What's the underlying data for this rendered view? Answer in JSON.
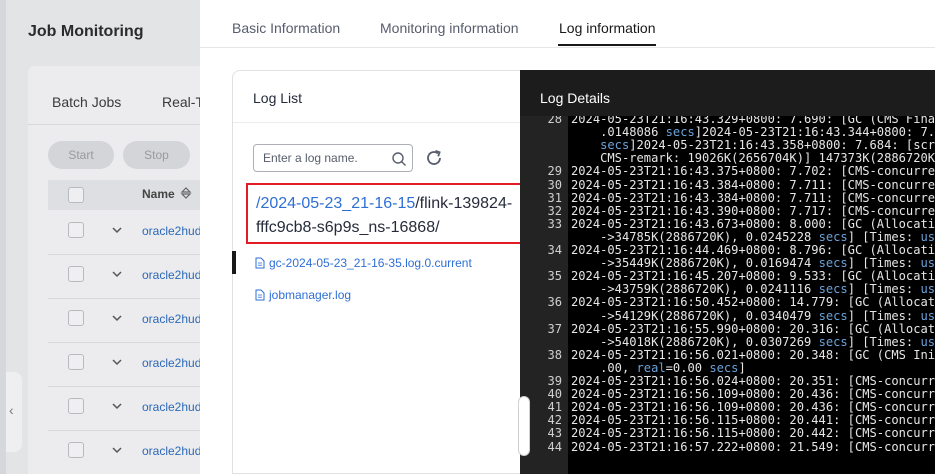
{
  "background": {
    "title": "Job Monitoring",
    "tabs": [
      "Batch Jobs",
      "Real-T"
    ],
    "buttons": {
      "start": "Start",
      "stop": "Stop"
    },
    "table_header": {
      "name": "Name"
    },
    "job_rows": [
      "oracle2hud",
      "oracle2hud",
      "oracle2hud",
      "oracle2hud",
      "oracle2hud",
      "oracle2hud"
    ]
  },
  "drawer": {
    "tabs": [
      {
        "label": "Basic Information"
      },
      {
        "label": "Monitoring information"
      },
      {
        "label": "Log information",
        "active": true
      }
    ],
    "log_list": {
      "title": "Log List",
      "search_placeholder": "Enter a log name.",
      "selected_path_link": "/2024-05-23_21-16-15",
      "selected_path_rest": "/flink-139824-fffc9cb8-s6p9s_ns-16868/",
      "files": [
        "gc-2024-05-23_21-16-35.log.0.current",
        "jobmanager.log"
      ]
    },
    "log_details": {
      "title": "Log Details",
      "lines": [
        {
          "n": "28",
          "parts": [
            {
              "t": "2024-05-23T21:16:43.329+0800: 7.690: [GC (CMS Final"
            }
          ]
        },
        {
          "n": "",
          "parts": [
            {
              "t": "    .0148086 "
            },
            {
              "t": "secs",
              "k": 1
            },
            {
              "t": "]2024-05-23T21:16:43.344+0800: 7.67"
            }
          ]
        },
        {
          "n": "",
          "parts": [
            {
              "t": "    "
            },
            {
              "t": "secs",
              "k": 1
            },
            {
              "t": "]2024-05-23T21:16:43.358+0800: 7.684: [scrub"
            }
          ]
        },
        {
          "n": "",
          "parts": [
            {
              "t": "    CMS-remark: 19026K(2656704K)] 147373K(2886720K),"
            }
          ]
        },
        {
          "n": "29",
          "parts": [
            {
              "t": "2024-05-23T21:16:43.375+0800: 7.702: [CMS-concurrent"
            }
          ]
        },
        {
          "n": "30",
          "parts": [
            {
              "t": "2024-05-23T21:16:43.384+0800: 7.711: [CMS-concurrent"
            }
          ]
        },
        {
          "n": "31",
          "parts": [
            {
              "t": "2024-05-23T21:16:43.384+0800: 7.711: [CMS-concurrent"
            }
          ]
        },
        {
          "n": "32",
          "parts": [
            {
              "t": "2024-05-23T21:16:43.390+0800: 7.717: [CMS-concurrent"
            }
          ]
        },
        {
          "n": "33",
          "parts": [
            {
              "t": "2024-05-23T21:16:43.673+0800: 8.000: [GC (Allocation"
            }
          ]
        },
        {
          "n": "",
          "parts": [
            {
              "t": "    ->34785K(2886720K), 0.0245228 "
            },
            {
              "t": "secs",
              "k": 1
            },
            {
              "t": "] [Times: "
            },
            {
              "t": "user",
              "k": 1
            }
          ]
        },
        {
          "n": "34",
          "parts": [
            {
              "t": "2024-05-23T21:16:44.469+0800: 8.796: [GC (Allocation"
            }
          ]
        },
        {
          "n": "",
          "parts": [
            {
              "t": "    ->35449K(2886720K), 0.0169474 "
            },
            {
              "t": "secs",
              "k": 1
            },
            {
              "t": "] [Times: "
            },
            {
              "t": "user",
              "k": 1
            }
          ]
        },
        {
          "n": "35",
          "parts": [
            {
              "t": "2024-05-23T21:16:45.207+0800: 9.533: [GC (Allocation"
            }
          ]
        },
        {
          "n": "",
          "parts": [
            {
              "t": "    ->43759K(2886720K), 0.0241116 "
            },
            {
              "t": "secs",
              "k": 1
            },
            {
              "t": "] [Times: "
            },
            {
              "t": "user",
              "k": 1
            }
          ]
        },
        {
          "n": "36",
          "parts": [
            {
              "t": "2024-05-23T21:16:50.452+0800: 14.779: [GC (Allocatio"
            }
          ]
        },
        {
          "n": "",
          "parts": [
            {
              "t": "    ->54129K(2886720K), 0.0340479 "
            },
            {
              "t": "secs",
              "k": 1
            },
            {
              "t": "] [Times: "
            },
            {
              "t": "user",
              "k": 1
            }
          ]
        },
        {
          "n": "37",
          "parts": [
            {
              "t": "2024-05-23T21:16:55.990+0800: 20.316: [GC (Allocatio"
            }
          ]
        },
        {
          "n": "",
          "parts": [
            {
              "t": "    ->54018K(2886720K), 0.0307269 "
            },
            {
              "t": "secs",
              "k": 1
            },
            {
              "t": "] [Times: "
            },
            {
              "t": "user",
              "k": 1
            }
          ]
        },
        {
          "n": "38",
          "parts": [
            {
              "t": "2024-05-23T21:16:56.021+0800: 20.348: [GC (CMS Initi"
            }
          ]
        },
        {
          "n": "",
          "parts": [
            {
              "t": "    .00, "
            },
            {
              "t": "real",
              "k": 1
            },
            {
              "t": "=0.00 "
            },
            {
              "t": "secs",
              "k": 1
            },
            {
              "t": "]"
            }
          ]
        },
        {
          "n": "39",
          "parts": [
            {
              "t": "2024-05-23T21:16:56.024+0800: 20.351: [CMS-concurren"
            }
          ]
        },
        {
          "n": "40",
          "parts": [
            {
              "t": "2024-05-23T21:16:56.109+0800: 20.436: [CMS-concurren"
            }
          ]
        },
        {
          "n": "41",
          "parts": [
            {
              "t": "2024-05-23T21:16:56.109+0800: 20.436: [CMS-concurren"
            }
          ]
        },
        {
          "n": "42",
          "parts": [
            {
              "t": "2024-05-23T21:16:56.115+0800: 20.441: [CMS-concurren"
            }
          ]
        },
        {
          "n": "43",
          "parts": [
            {
              "t": "2024-05-23T21:16:56.115+0800: 20.442: [CMS-concurren"
            }
          ]
        },
        {
          "n": "44",
          "parts": [
            {
              "t": "2024-05-23T21:16:57.222+0800: 21.549: [CMS-concurren"
            }
          ]
        }
      ]
    }
  }
}
